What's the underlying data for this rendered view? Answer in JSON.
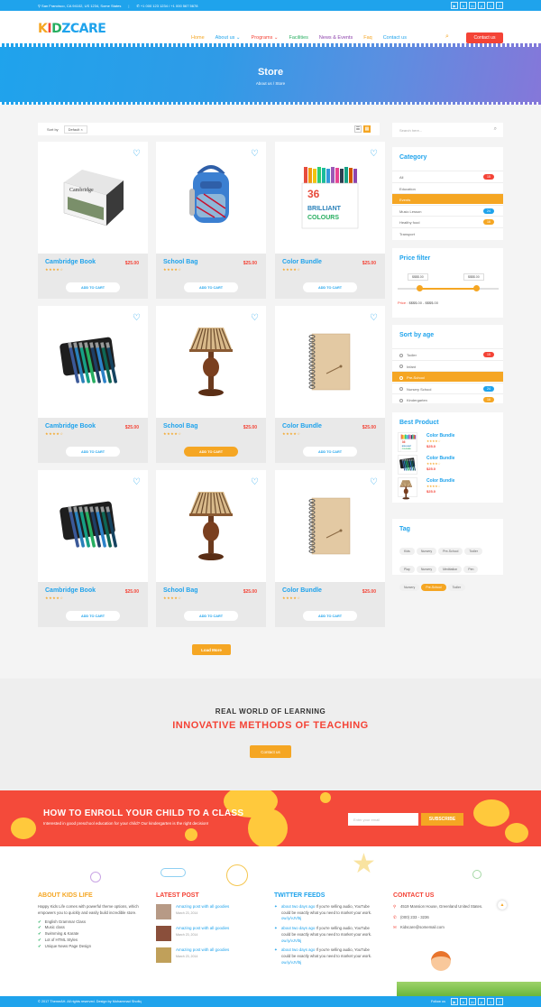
{
  "topbar": {
    "address": "San Francisco, CA 94102, US 1234, Some States",
    "phone": "+1 000 123 1234 / +1 000 567 5678",
    "socials": [
      {
        "icon": "youtube-icon",
        "glyph": "▶"
      },
      {
        "icon": "behance-icon",
        "glyph": "b"
      },
      {
        "icon": "linkedin-icon",
        "glyph": "in"
      },
      {
        "icon": "pinterest-icon",
        "glyph": "p"
      },
      {
        "icon": "twitter-icon",
        "glyph": "t"
      },
      {
        "icon": "facebook-icon",
        "glyph": "f"
      }
    ]
  },
  "logo": {
    "letters": [
      "K",
      "I",
      "D",
      "Z",
      "C",
      "A",
      "R",
      "E"
    ],
    "colors": [
      "#f5a623",
      "#f44336",
      "#27ae60",
      "#1fa3ec",
      "#1fa3ec",
      "#1fa3ec",
      "#1fa3ec",
      "#1fa3ec"
    ]
  },
  "nav": [
    {
      "label": "Home",
      "color": "#f5a623"
    },
    {
      "label": "About us ⌄",
      "color": "#1fa3ec"
    },
    {
      "label": "Programs ⌄",
      "color": "#f44336"
    },
    {
      "label": "Facilities",
      "color": "#27ae60"
    },
    {
      "label": "News & Events",
      "color": "#8e44ad"
    },
    {
      "label": "Faq",
      "color": "#f5a623"
    },
    {
      "label": "Contact us",
      "color": "#1fa3ec"
    }
  ],
  "header": {
    "contact_btn": "Contact us",
    "search_icon": "⌕"
  },
  "hero": {
    "title": "Store",
    "breadcrumb": "About us / Store"
  },
  "toolbar": {
    "sort_label": "Sort by",
    "sort_value": "Default ×"
  },
  "products": [
    {
      "name": "Cambridge Book",
      "price": "$25.00",
      "stars": "★★★★☆",
      "cart": "ADD TO CART",
      "image": "book"
    },
    {
      "name": "School Bag",
      "price": "$25.00",
      "stars": "★★★★☆",
      "cart": "ADD TO CART",
      "image": "bag"
    },
    {
      "name": "Color Bundle",
      "price": "$25.00",
      "stars": "★★★★☆",
      "cart": "ADD TO CART",
      "image": "markers"
    },
    {
      "name": "Cambridge Book",
      "price": "$25.00",
      "stars": "★★★★☆",
      "cart": "ADD TO CART",
      "image": "pens"
    },
    {
      "name": "School Bag",
      "price": "$25.00",
      "stars": "★★★★☆",
      "cart": "ADD TO CART",
      "image": "lamp",
      "active": true
    },
    {
      "name": "Color Bundle",
      "price": "$25.00",
      "stars": "★★★★☆",
      "cart": "ADD TO CART",
      "image": "notebook"
    },
    {
      "name": "Cambridge Book",
      "price": "$25.00",
      "stars": "★★★★☆",
      "cart": "ADD TO CART",
      "image": "pens"
    },
    {
      "name": "School Bag",
      "price": "$25.00",
      "stars": "★★★★☆",
      "cart": "ADD TO CART",
      "image": "lamp"
    },
    {
      "name": "Color Bundle",
      "price": "$25.00",
      "stars": "★★★★☆",
      "cart": "ADD TO CART",
      "image": "notebook"
    }
  ],
  "load_more": "Load More",
  "sidebar": {
    "search_placeholder": "Search here...",
    "category_title": "Category",
    "categories": [
      {
        "label": "All",
        "count": "15",
        "color": "#f44336"
      },
      {
        "label": "Education",
        "count": "",
        "color": ""
      },
      {
        "label": "Events",
        "count": "",
        "color": "",
        "active": true
      },
      {
        "label": "Music Lesson",
        "count": "24",
        "color": "#1fa3ec"
      },
      {
        "label": "Healthy food",
        "count": "16",
        "color": "#f5a623"
      },
      {
        "label": "Transport",
        "count": "",
        "color": ""
      }
    ],
    "price_title": "Price filter",
    "price_min": "$$$$.00",
    "price_max": "$$$$.00",
    "price_label": "Price :",
    "price_range": "$$$$.00 - $$$$.00",
    "price_range_fraction": [
      0.22,
      0.78
    ],
    "age_title": "Sort by age",
    "ages": [
      {
        "label": "Todler",
        "count": "15",
        "color": "#f44336"
      },
      {
        "label": "Infant",
        "count": "",
        "color": ""
      },
      {
        "label": "Pre-School",
        "count": "",
        "color": "",
        "active": true
      },
      {
        "label": "Nursery School",
        "count": "24",
        "color": "#1fa3ec"
      },
      {
        "label": "Kindergarten",
        "count": "16",
        "color": "#f5a623"
      }
    ],
    "best_title": "Best Product",
    "best": [
      {
        "name": "Color Bundle",
        "stars": "★★★★☆",
        "price": "$25.0",
        "image": "markers"
      },
      {
        "name": "Color Bundle",
        "stars": "★★★★☆",
        "price": "$25.0",
        "image": "pens"
      },
      {
        "name": "Color Bundle",
        "stars": "★★★★☆",
        "price": "$25.0",
        "image": "lamp"
      }
    ],
    "tag_title": "Tag",
    "tags": [
      {
        "label": "Kids"
      },
      {
        "label": "Nursery"
      },
      {
        "label": "Pre-School"
      },
      {
        "label": "Todler"
      },
      {
        "label": "Play"
      },
      {
        "label": "Nursery"
      },
      {
        "label": "Meditation"
      },
      {
        "label": "Pen"
      },
      {
        "label": "Nursery"
      },
      {
        "label": "Pre-School",
        "active": true
      },
      {
        "label": "Todler"
      }
    ]
  },
  "promo": {
    "line1": "REAL WORLD OF LEARNING",
    "line2": "INNOVATIVE METHODS OF TEACHING",
    "button": "Contact us"
  },
  "enroll": {
    "title": "HOW TO ENROLL YOUR CHILD TO A CLASS",
    "text": "Interested in good preschool education for your child? Our kindergarten is the right decision!",
    "email_placeholder": "Enter your email",
    "subscribe": "SUBSCRIBE"
  },
  "footer": {
    "about_title": "ABOUT KIDS LIFE",
    "about_text": "Happy Kids Life comes with powerful theme options, which empowers you to quickly and easily build incredible store.",
    "about_items": [
      "English Grammar Class",
      "Music class",
      "Swimming & Karate",
      "Lot of HTML Styles",
      "Unique News Page Design"
    ],
    "posts_title": "LATEST POST",
    "posts": [
      {
        "title": "Amazing post with all goodies",
        "date": "March 23, 2014"
      },
      {
        "title": "Amazing post with all goodies",
        "date": "March 23, 2014"
      },
      {
        "title": "Amazing post with all goodies",
        "date": "March 23, 2014"
      }
    ],
    "twitter_title": "TWITTER FEEDS",
    "tweets": [
      {
        "time": "about two days ago",
        "text": "If you're selling audio, YouTube could be exactly what you need to market your work.",
        "link": "ow.ly/vJVl5j"
      },
      {
        "time": "about two days ago",
        "text": "If you're selling audio, YouTube could be exactly what you need to market your work.",
        "link": "ow.ly/vJVl5j"
      },
      {
        "time": "about two days ago",
        "text": "If you're selling audio, YouTube could be exactly what you need to market your work.",
        "link": "ow.ly/vJVl5j"
      }
    ],
    "contact_title": "CONTACT US",
    "address": "4519 Mansion House, Greenland United States.",
    "phone": "(000) 233 - 3236",
    "email": "Kidscare@somemail.com"
  },
  "bottombar": {
    "copyright": "© 2017 ThemeAH. All rights reserved. Design by Mohammad Shofiq",
    "follow": "Follow us"
  }
}
